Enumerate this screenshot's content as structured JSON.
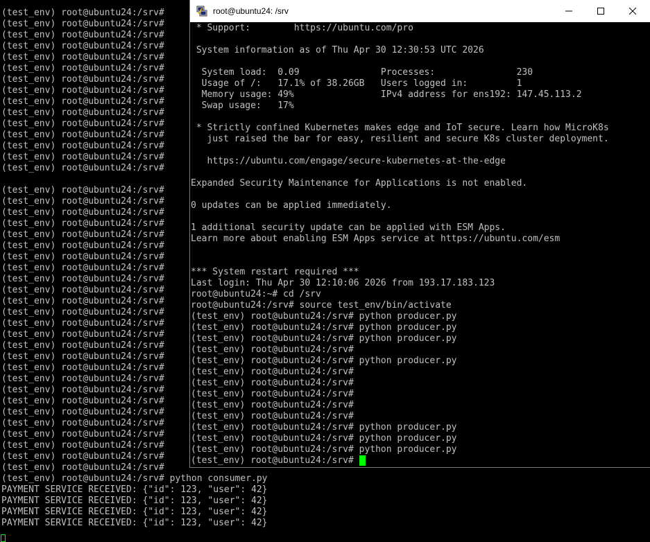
{
  "background_terminal": {
    "lines": [
      "(test_env) root@ubuntu24:/srv#",
      "(test_env) root@ubuntu24:/srv#",
      "(test_env) root@ubuntu24:/srv#",
      "(test_env) root@ubuntu24:/srv#",
      "(test_env) root@ubuntu24:/srv#",
      "(test_env) root@ubuntu24:/srv#",
      "(test_env) root@ubuntu24:/srv#",
      "(test_env) root@ubuntu24:/srv#",
      "(test_env) root@ubuntu24:/srv#",
      "(test_env) root@ubuntu24:/srv#",
      "(test_env) root@ubuntu24:/srv#",
      "(test_env) root@ubuntu24:/srv#",
      "(test_env) root@ubuntu24:/srv#",
      "(test_env) root@ubuntu24:/srv#",
      "(test_env) root@ubuntu24:/srv#",
      "",
      "(test_env) root@ubuntu24:/srv#",
      "(test_env) root@ubuntu24:/srv#",
      "(test_env) root@ubuntu24:/srv#",
      "(test_env) root@ubuntu24:/srv#",
      "(test_env) root@ubuntu24:/srv#",
      "(test_env) root@ubuntu24:/srv#",
      "(test_env) root@ubuntu24:/srv#",
      "(test_env) root@ubuntu24:/srv#",
      "(test_env) root@ubuntu24:/srv#",
      "(test_env) root@ubuntu24:/srv#",
      "(test_env) root@ubuntu24:/srv#",
      "(test_env) root@ubuntu24:/srv#",
      "(test_env) root@ubuntu24:/srv#",
      "(test_env) root@ubuntu24:/srv#",
      "(test_env) root@ubuntu24:/srv#",
      "(test_env) root@ubuntu24:/srv#",
      "(test_env) root@ubuntu24:/srv#",
      "(test_env) root@ubuntu24:/srv#",
      "(test_env) root@ubuntu24:/srv#",
      "(test_env) root@ubuntu24:/srv#",
      "(test_env) root@ubuntu24:/srv#",
      "(test_env) root@ubuntu24:/srv#",
      "(test_env) root@ubuntu24:/srv#",
      "(test_env) root@ubuntu24:/srv#",
      "(test_env) root@ubuntu24:/srv#",
      "(test_env) root@ubuntu24:/srv#",
      "(test_env) root@ubuntu24:/srv# python consumer.py",
      "PAYMENT SERVICE RECEIVED: {\"id\": 123, \"user\": 42}",
      "PAYMENT SERVICE RECEIVED: {\"id\": 123, \"user\": 42}",
      "PAYMENT SERVICE RECEIVED: {\"id\": 123, \"user\": 42}",
      "PAYMENT SERVICE RECEIVED: {\"id\": 123, \"user\": 42}"
    ]
  },
  "window": {
    "title": "root@ubuntu24: /srv",
    "app_icon": "putty-icon",
    "minimize_icon": "minimize-icon",
    "maximize_icon": "maximize-icon",
    "close_icon": "close-icon"
  },
  "foreground_terminal": {
    "lines": [
      " * Support:        https://ubuntu.com/pro",
      "",
      " System information as of Thu Apr 30 12:30:53 UTC 2026",
      "",
      "  System load:  0.09               Processes:               230",
      "  Usage of /:   17.1% of 38.26GB   Users logged in:         1",
      "  Memory usage: 49%                IPv4 address for ens192: 147.45.113.2",
      "  Swap usage:   17%",
      "",
      " * Strictly confined Kubernetes makes edge and IoT secure. Learn how MicroK8s",
      "   just raised the bar for easy, resilient and secure K8s cluster deployment.",
      "",
      "   https://ubuntu.com/engage/secure-kubernetes-at-the-edge",
      "",
      "Expanded Security Maintenance for Applications is not enabled.",
      "",
      "0 updates can be applied immediately.",
      "",
      "1 additional security update can be applied with ESM Apps.",
      "Learn more about enabling ESM Apps service at https://ubuntu.com/esm",
      "",
      "",
      "*** System restart required ***",
      "Last login: Thu Apr 30 12:10:06 2026 from 193.17.183.123",
      "root@ubuntu24:~# cd /srv",
      "root@ubuntu24:/srv# source test_env/bin/activate",
      "(test_env) root@ubuntu24:/srv# python producer.py",
      "(test_env) root@ubuntu24:/srv# python producer.py",
      "(test_env) root@ubuntu24:/srv# python producer.py",
      "(test_env) root@ubuntu24:/srv#",
      "(test_env) root@ubuntu24:/srv# python producer.py",
      "(test_env) root@ubuntu24:/srv#",
      "(test_env) root@ubuntu24:/srv#",
      "(test_env) root@ubuntu24:/srv#",
      "(test_env) root@ubuntu24:/srv#",
      "(test_env) root@ubuntu24:/srv#",
      "(test_env) root@ubuntu24:/srv# python producer.py",
      "(test_env) root@ubuntu24:/srv# python producer.py",
      "(test_env) root@ubuntu24:/srv# python producer.py"
    ],
    "current_prompt": "(test_env) root@ubuntu24:/srv# "
  },
  "colors": {
    "terminal_bg": "#000000",
    "terminal_fg": "#c0c0c0",
    "cursor": "#00ff00",
    "titlebar_bg": "#ffffff"
  }
}
